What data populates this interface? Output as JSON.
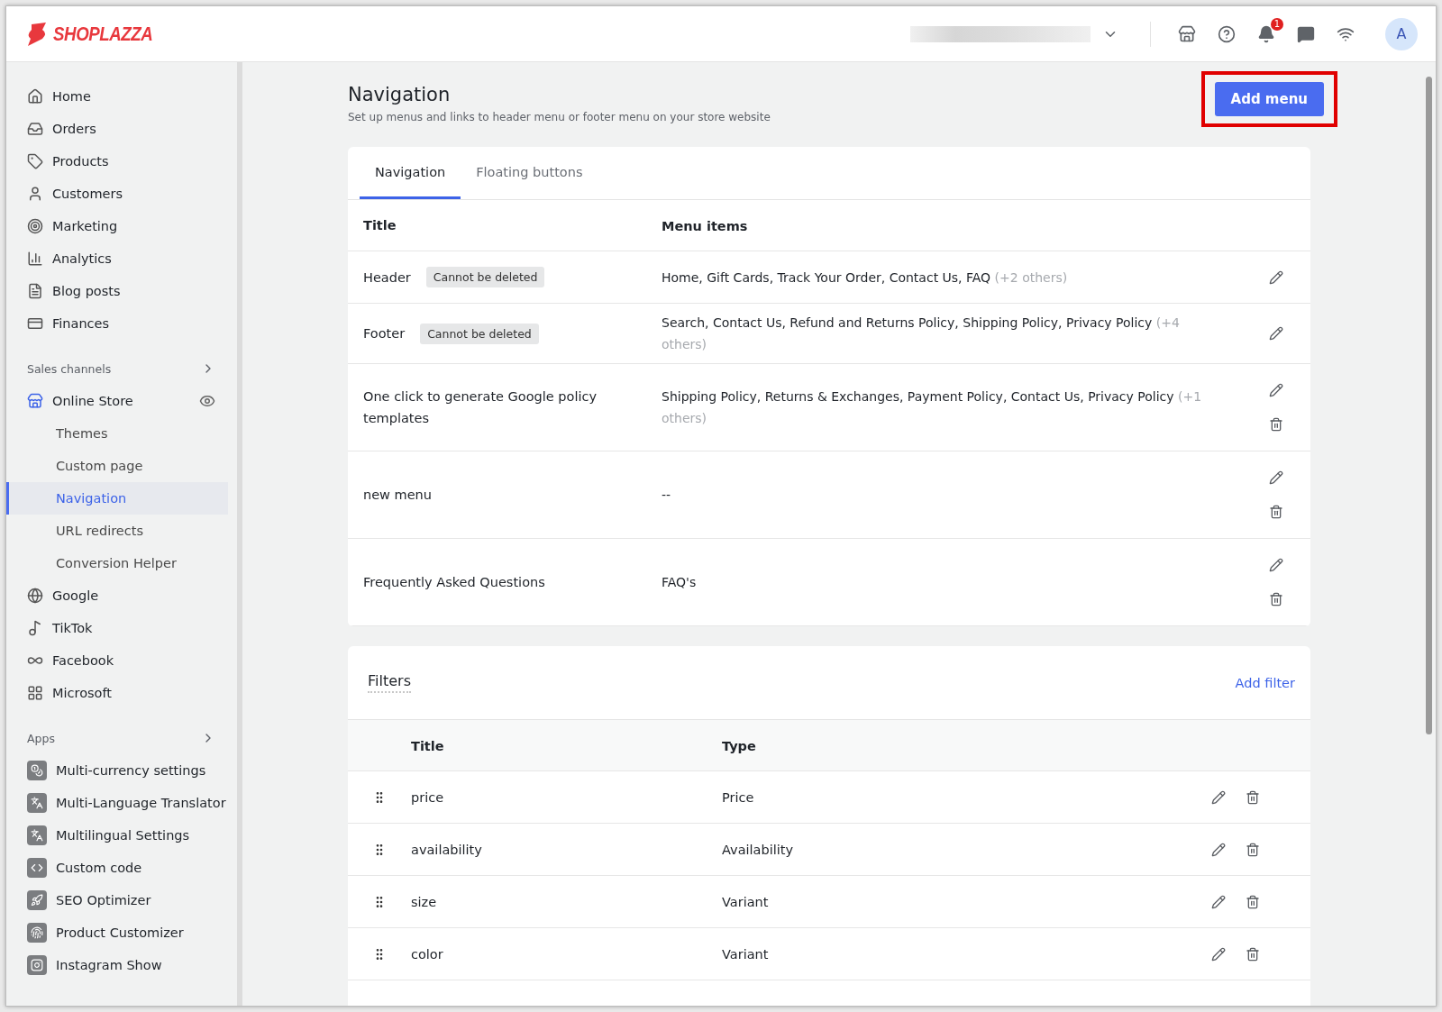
{
  "topbar": {
    "logo": "SHOPLAZZA",
    "notifications": "1",
    "avatar": "A"
  },
  "sidebar": {
    "main": [
      {
        "label": "Home",
        "selected": false
      },
      {
        "label": "Orders",
        "selected": false
      },
      {
        "label": "Products",
        "selected": false
      },
      {
        "label": "Customers",
        "selected": false
      },
      {
        "label": "Marketing",
        "selected": false
      },
      {
        "label": "Analytics",
        "selected": false
      },
      {
        "label": "Blog posts",
        "selected": false
      },
      {
        "label": "Finances",
        "selected": false
      }
    ],
    "sales_channels": {
      "title": "Sales channels",
      "store": {
        "label": "Online Store",
        "children": [
          {
            "label": "Themes",
            "selected": false
          },
          {
            "label": "Custom page",
            "selected": false
          },
          {
            "label": "Navigation",
            "selected": true
          },
          {
            "label": "URL redirects",
            "selected": false
          },
          {
            "label": "Conversion Helper",
            "selected": false
          }
        ]
      },
      "channels": [
        {
          "label": "Google",
          "selected": false
        },
        {
          "label": "TikTok",
          "selected": false
        },
        {
          "label": "Facebook",
          "selected": false
        },
        {
          "label": "Microsoft",
          "selected": false
        }
      ]
    },
    "apps": {
      "title": "Apps",
      "items": [
        {
          "label": "Multi-currency settings",
          "selected": false
        },
        {
          "label": "Multi-Language Translator",
          "selected": false
        },
        {
          "label": "Multilingual Settings",
          "selected": false
        },
        {
          "label": "Custom code",
          "selected": false
        },
        {
          "label": "SEO Optimizer",
          "selected": false
        },
        {
          "label": "Product Customizer",
          "selected": false
        },
        {
          "label": "Instagram Show",
          "selected": false
        }
      ]
    }
  },
  "page": {
    "title": "Navigation",
    "subtitle": "Set up menus and links to header menu or footer menu on your store website",
    "add_button": "Add menu",
    "highlighted": true
  },
  "tabs": [
    {
      "label": "Navigation",
      "selected": true
    },
    {
      "label": "Floating buttons",
      "selected": false
    }
  ],
  "menus": {
    "columns": [
      "Title",
      "Menu items"
    ],
    "rows": [
      {
        "title": "Header",
        "badge": "Cannot be deleted",
        "items": "Home, Gift Cards, Track Your Order, Contact Us, FAQ",
        "more": "(+2 others)",
        "deletable": false
      },
      {
        "title": "Footer",
        "badge": "Cannot be deleted",
        "items": "Search, Contact Us, Refund and Returns Policy, Shipping Policy, Privacy Policy",
        "more": "(+4 others)",
        "deletable": false
      },
      {
        "title": "One click to generate Google policy templates",
        "items": "Shipping Policy, Returns & Exchanges, Payment Policy, Contact Us, Privacy Policy",
        "more": "(+1 others)",
        "deletable": true
      },
      {
        "title": "new menu",
        "items": "--",
        "deletable": true
      },
      {
        "title": "Frequently Asked Questions",
        "items": "FAQ's",
        "deletable": true
      }
    ]
  },
  "filters": {
    "title": "Filters",
    "add_link": "Add filter",
    "columns": [
      "Title",
      "Type"
    ],
    "rows": [
      {
        "title": "price",
        "type": "Price"
      },
      {
        "title": "availability",
        "type": "Availability"
      },
      {
        "title": "size",
        "type": "Variant"
      },
      {
        "title": "color",
        "type": "Variant"
      }
    ]
  }
}
